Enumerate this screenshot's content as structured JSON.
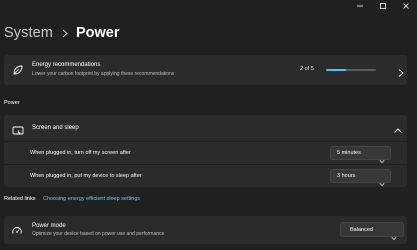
{
  "window": {
    "controls": {
      "minimize_icon": "minimize-icon",
      "maximize_icon": "maximize-icon",
      "close_icon": "close-icon"
    }
  },
  "header": {
    "parent": "System",
    "separator_icon": "chevron-right-icon",
    "current": "Power"
  },
  "recommendations": {
    "icon": "leaf-icon",
    "title": "Energy recommendations",
    "subtitle": "Lower your carbon footprint by applying these recommendations",
    "count": "2 of 5",
    "progress": 0.4,
    "chevron_icon": "chevron-right-icon"
  },
  "power_section": {
    "title": "Power",
    "screen_sleep": {
      "icon": "screen-sleep-icon",
      "title": "Screen and sleep",
      "chevron_icon": "chevron-up-icon",
      "rows": [
        {
          "label": "When plugged in, turn off my screen after",
          "value": "5 minutes"
        },
        {
          "label": "When plugged in, put my device to sleep after",
          "value": "3 hours"
        }
      ]
    }
  },
  "related": {
    "label": "Related links",
    "link": "Choosing energy efficient sleep settings"
  },
  "power_mode": {
    "icon": "power-mode-icon",
    "title": "Power mode",
    "subtitle": "Optimize your device based on power use and performance",
    "value": "Balanced"
  },
  "colors": {
    "background": "#202020",
    "card": "#2b2b2b",
    "accent": "#4cc2ff",
    "link": "#60cdff"
  }
}
